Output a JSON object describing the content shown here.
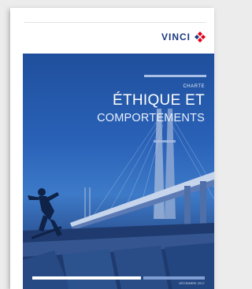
{
  "brand": {
    "name": "VINCI",
    "colors": {
      "blue": "#1c3a80",
      "red": "#e2001a",
      "hero": "#2a62b8"
    }
  },
  "cover": {
    "kicker": "CHARTE",
    "title_line1": "ÉTHIQUE ET",
    "title_line2": "COMPORTEMENTS",
    "date": "DÉCEMBRE 2017",
    "image": "skateboarder-under-bridge-photo"
  }
}
